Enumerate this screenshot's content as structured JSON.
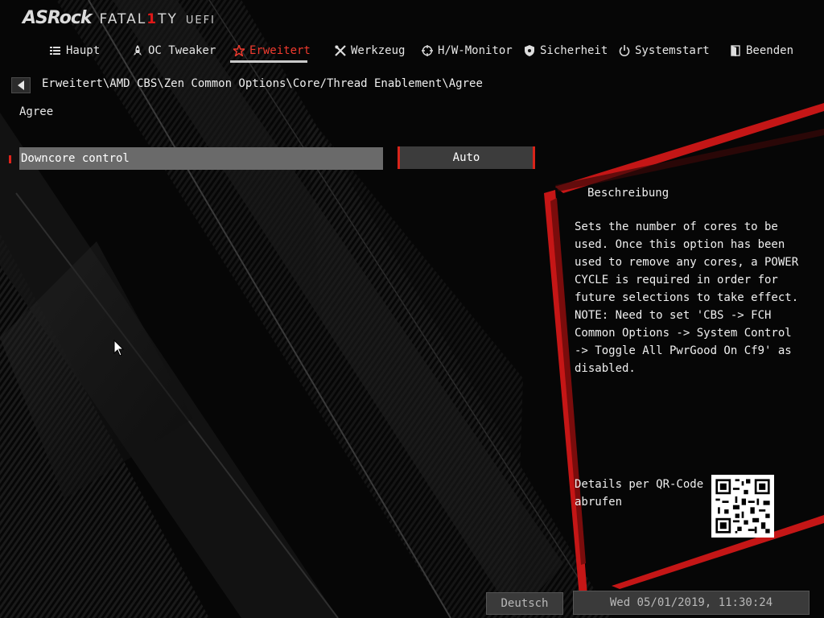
{
  "branding": {
    "brand": "ASRock",
    "product_pre": "FATAL",
    "product_one": "1",
    "product_post": "TY",
    "uefi": "UEFI"
  },
  "nav": [
    {
      "label": "Haupt",
      "icon": "list-icon"
    },
    {
      "label": "OC Tweaker",
      "icon": "rocket-icon"
    },
    {
      "label": "Erweitert",
      "icon": "star-icon",
      "active": true
    },
    {
      "label": "Werkzeug",
      "icon": "tools-icon"
    },
    {
      "label": "H/W-Monitor",
      "icon": "crosshair-icon"
    },
    {
      "label": "Sicherheit",
      "icon": "shield-icon"
    },
    {
      "label": "Systemstart",
      "icon": "power-icon"
    },
    {
      "label": "Beenden",
      "icon": "exit-door-icon"
    }
  ],
  "breadcrumb": "Erweitert\\AMD CBS\\Zen Common Options\\Core/Thread Enablement\\Agree",
  "section_title": "Agree",
  "settings": [
    {
      "label": "Downcore control",
      "value": "Auto"
    }
  ],
  "description": {
    "title": "Beschreibung",
    "body": "Sets the number of cores to be\nused. Once this option has been\nused to remove any cores, a POWER\nCYCLE is required in order for\nfuture selections to take effect.\nNOTE: Need to set 'CBS -> FCH\nCommon Options -> System Control\n-> Toggle All PwrGood On Cf9' as\ndisabled."
  },
  "qr": {
    "label": "Details per QR-Code abrufen"
  },
  "footer": {
    "language": "Deutsch",
    "datetime": "Wed 05/01/2019, 11:30:24"
  },
  "colors": {
    "accent": "#e0231b",
    "active_tab": "#f03a2e",
    "background": "#050505"
  }
}
